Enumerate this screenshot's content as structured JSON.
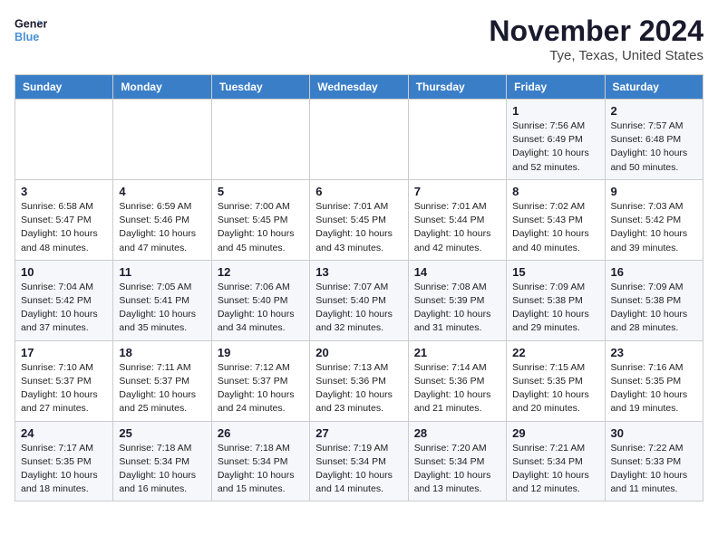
{
  "header": {
    "logo_line1": "General",
    "logo_line2": "Blue",
    "month": "November 2024",
    "location": "Tye, Texas, United States"
  },
  "weekdays": [
    "Sunday",
    "Monday",
    "Tuesday",
    "Wednesday",
    "Thursday",
    "Friday",
    "Saturday"
  ],
  "weeks": [
    [
      {
        "day": "",
        "info": ""
      },
      {
        "day": "",
        "info": ""
      },
      {
        "day": "",
        "info": ""
      },
      {
        "day": "",
        "info": ""
      },
      {
        "day": "",
        "info": ""
      },
      {
        "day": "1",
        "info": "Sunrise: 7:56 AM\nSunset: 6:49 PM\nDaylight: 10 hours\nand 52 minutes."
      },
      {
        "day": "2",
        "info": "Sunrise: 7:57 AM\nSunset: 6:48 PM\nDaylight: 10 hours\nand 50 minutes."
      }
    ],
    [
      {
        "day": "3",
        "info": "Sunrise: 6:58 AM\nSunset: 5:47 PM\nDaylight: 10 hours\nand 48 minutes."
      },
      {
        "day": "4",
        "info": "Sunrise: 6:59 AM\nSunset: 5:46 PM\nDaylight: 10 hours\nand 47 minutes."
      },
      {
        "day": "5",
        "info": "Sunrise: 7:00 AM\nSunset: 5:45 PM\nDaylight: 10 hours\nand 45 minutes."
      },
      {
        "day": "6",
        "info": "Sunrise: 7:01 AM\nSunset: 5:45 PM\nDaylight: 10 hours\nand 43 minutes."
      },
      {
        "day": "7",
        "info": "Sunrise: 7:01 AM\nSunset: 5:44 PM\nDaylight: 10 hours\nand 42 minutes."
      },
      {
        "day": "8",
        "info": "Sunrise: 7:02 AM\nSunset: 5:43 PM\nDaylight: 10 hours\nand 40 minutes."
      },
      {
        "day": "9",
        "info": "Sunrise: 7:03 AM\nSunset: 5:42 PM\nDaylight: 10 hours\nand 39 minutes."
      }
    ],
    [
      {
        "day": "10",
        "info": "Sunrise: 7:04 AM\nSunset: 5:42 PM\nDaylight: 10 hours\nand 37 minutes."
      },
      {
        "day": "11",
        "info": "Sunrise: 7:05 AM\nSunset: 5:41 PM\nDaylight: 10 hours\nand 35 minutes."
      },
      {
        "day": "12",
        "info": "Sunrise: 7:06 AM\nSunset: 5:40 PM\nDaylight: 10 hours\nand 34 minutes."
      },
      {
        "day": "13",
        "info": "Sunrise: 7:07 AM\nSunset: 5:40 PM\nDaylight: 10 hours\nand 32 minutes."
      },
      {
        "day": "14",
        "info": "Sunrise: 7:08 AM\nSunset: 5:39 PM\nDaylight: 10 hours\nand 31 minutes."
      },
      {
        "day": "15",
        "info": "Sunrise: 7:09 AM\nSunset: 5:38 PM\nDaylight: 10 hours\nand 29 minutes."
      },
      {
        "day": "16",
        "info": "Sunrise: 7:09 AM\nSunset: 5:38 PM\nDaylight: 10 hours\nand 28 minutes."
      }
    ],
    [
      {
        "day": "17",
        "info": "Sunrise: 7:10 AM\nSunset: 5:37 PM\nDaylight: 10 hours\nand 27 minutes."
      },
      {
        "day": "18",
        "info": "Sunrise: 7:11 AM\nSunset: 5:37 PM\nDaylight: 10 hours\nand 25 minutes."
      },
      {
        "day": "19",
        "info": "Sunrise: 7:12 AM\nSunset: 5:37 PM\nDaylight: 10 hours\nand 24 minutes."
      },
      {
        "day": "20",
        "info": "Sunrise: 7:13 AM\nSunset: 5:36 PM\nDaylight: 10 hours\nand 23 minutes."
      },
      {
        "day": "21",
        "info": "Sunrise: 7:14 AM\nSunset: 5:36 PM\nDaylight: 10 hours\nand 21 minutes."
      },
      {
        "day": "22",
        "info": "Sunrise: 7:15 AM\nSunset: 5:35 PM\nDaylight: 10 hours\nand 20 minutes."
      },
      {
        "day": "23",
        "info": "Sunrise: 7:16 AM\nSunset: 5:35 PM\nDaylight: 10 hours\nand 19 minutes."
      }
    ],
    [
      {
        "day": "24",
        "info": "Sunrise: 7:17 AM\nSunset: 5:35 PM\nDaylight: 10 hours\nand 18 minutes."
      },
      {
        "day": "25",
        "info": "Sunrise: 7:18 AM\nSunset: 5:34 PM\nDaylight: 10 hours\nand 16 minutes."
      },
      {
        "day": "26",
        "info": "Sunrise: 7:18 AM\nSunset: 5:34 PM\nDaylight: 10 hours\nand 15 minutes."
      },
      {
        "day": "27",
        "info": "Sunrise: 7:19 AM\nSunset: 5:34 PM\nDaylight: 10 hours\nand 14 minutes."
      },
      {
        "day": "28",
        "info": "Sunrise: 7:20 AM\nSunset: 5:34 PM\nDaylight: 10 hours\nand 13 minutes."
      },
      {
        "day": "29",
        "info": "Sunrise: 7:21 AM\nSunset: 5:34 PM\nDaylight: 10 hours\nand 12 minutes."
      },
      {
        "day": "30",
        "info": "Sunrise: 7:22 AM\nSunset: 5:33 PM\nDaylight: 10 hours\nand 11 minutes."
      }
    ]
  ]
}
